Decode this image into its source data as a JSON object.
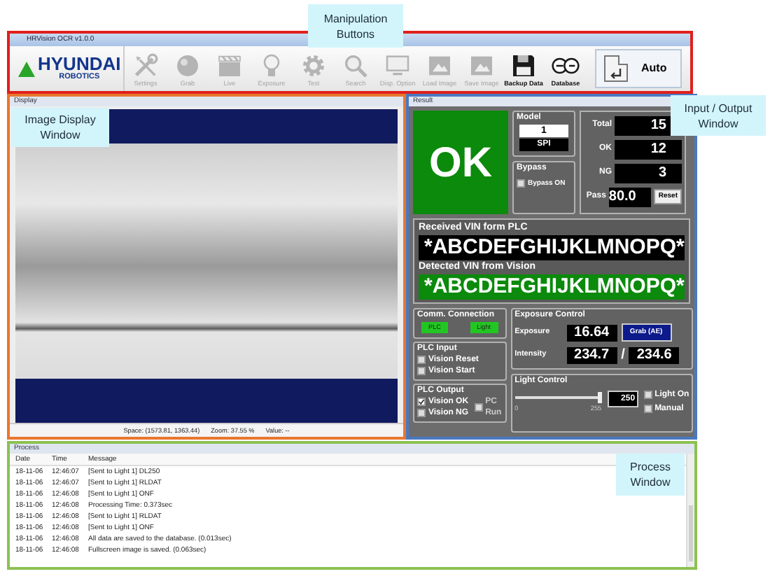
{
  "window": {
    "title": "HRVision OCR v1.0.0"
  },
  "callouts": [
    {
      "text": "Manipulation Buttons"
    },
    {
      "text": "Image Display Window"
    },
    {
      "text": "Input / Output Window"
    },
    {
      "text": "Process Window"
    }
  ],
  "toolbar": {
    "logo": {
      "brand": "HYUNDAI",
      "sub": "ROBOTICS"
    },
    "buttons": [
      {
        "label": "Settings",
        "disabled": true
      },
      {
        "label": "Grab",
        "disabled": true
      },
      {
        "label": "Live",
        "disabled": true
      },
      {
        "label": "Exposure",
        "disabled": true
      },
      {
        "label": "Test",
        "disabled": true
      },
      {
        "label": "Search",
        "disabled": true
      },
      {
        "label": "Disp. Option",
        "disabled": true
      },
      {
        "label": "Load Image",
        "disabled": true
      },
      {
        "label": "Save Image",
        "disabled": true
      },
      {
        "label": "Backup Data",
        "disabled": false
      },
      {
        "label": "Database",
        "disabled": false
      }
    ],
    "mode_button": {
      "label": "Auto"
    }
  },
  "display": {
    "caption": "Display",
    "status": [
      "Space: (1573.81, 1363.44)",
      "Zoom: 37.55 %",
      "Value: --"
    ]
  },
  "result": {
    "caption": "Result",
    "verdict": "OK",
    "model": {
      "title": "Model",
      "number": "1",
      "name": "SPI"
    },
    "bypass": {
      "title": "Bypass",
      "label": "Bypass ON",
      "checked": false
    },
    "counters": [
      {
        "label": "Total",
        "value": "15"
      },
      {
        "label": "OK",
        "value": "12"
      },
      {
        "label": "NG",
        "value": "3"
      },
      {
        "label": "Pass",
        "value": "80.0"
      }
    ],
    "reset_button": "Reset",
    "received": {
      "label": "Received VIN form PLC",
      "value": "*ABCDEFGHIJKLMNOPQ*"
    },
    "detected": {
      "label": "Detected VIN from Vision",
      "value": "*ABCDEFGHIJKLMNOPQ*"
    },
    "comm": {
      "title": "Comm. Connection",
      "items": [
        {
          "label": "PLC",
          "on": true
        },
        {
          "label": "Light",
          "on": true
        }
      ]
    },
    "plc_input": {
      "title": "PLC Input",
      "items": [
        {
          "label": "Vision Reset",
          "checked": false
        },
        {
          "label": "Vision Start",
          "checked": false
        }
      ]
    },
    "plc_output": {
      "title": "PLC Output",
      "items": [
        {
          "label": "Vision OK",
          "checked": true
        },
        {
          "label": "Vision NG",
          "checked": false
        }
      ],
      "pc_run": {
        "label": "PC Run",
        "checked": false
      }
    },
    "exposure": {
      "title": "Exposure Control",
      "exposure_label": "Exposure",
      "exposure": "16.64",
      "grab_button": "Grab (AE)",
      "intensity_label": "Intensity",
      "intensity": "234.7",
      "separator": "/",
      "target": "234.6"
    },
    "light": {
      "title": "Light Control",
      "level": 0.98,
      "min": "0",
      "max": "255",
      "value": "250",
      "options": [
        {
          "label": "Light On",
          "checked": false
        },
        {
          "label": "Manual",
          "checked": false
        }
      ]
    }
  },
  "process": {
    "caption": "Process",
    "columns": [
      "Date",
      "Time",
      "Message"
    ],
    "rows": [
      [
        "18-11-06",
        "12:46:07",
        "[Sent to Light 1] DL250"
      ],
      [
        "18-11-06",
        "12:46:07",
        "[Sent to Light 1] RLDAT"
      ],
      [
        "18-11-06",
        "12:46:08",
        "[Sent to Light 1] ONF"
      ],
      [
        "18-11-06",
        "12:46:08",
        "Processing Time: 0.373sec"
      ],
      [
        "18-11-06",
        "12:46:08",
        "[Sent to Light 1] RLDAT"
      ],
      [
        "18-11-06",
        "12:46:08",
        "[Sent to Light 1] ONF"
      ],
      [
        "18-11-06",
        "12:46:08",
        "All data are saved to the database. (0.013sec)"
      ],
      [
        "18-11-06",
        "12:46:08",
        "Fullscreen image is saved. (0.063sec)"
      ]
    ]
  }
}
